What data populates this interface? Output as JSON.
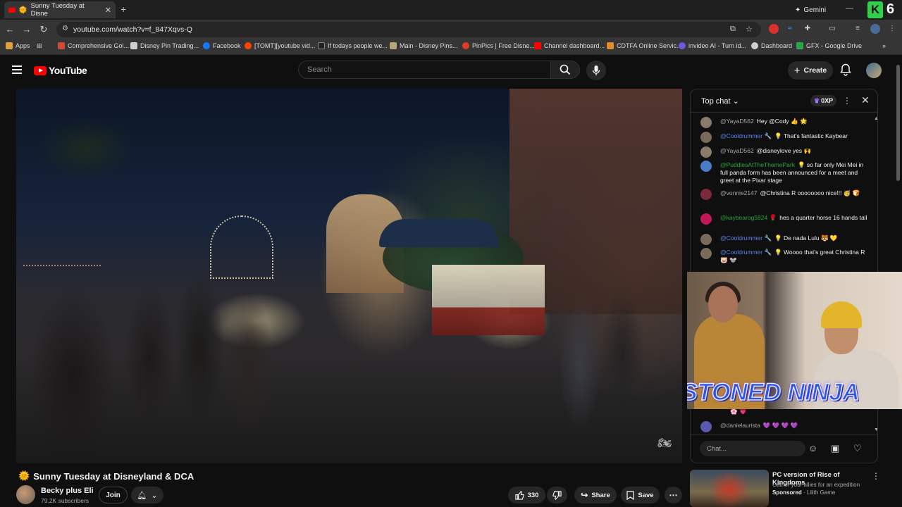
{
  "browser": {
    "tab_title": "Sunny Tuesday at Disne",
    "url": "youtube.com/watch?v=f_847Xqvs-Q",
    "gemini_label": "Gemini",
    "badge_count": "6",
    "bookmarks": [
      {
        "label": "Apps",
        "color": "#e0a040"
      },
      {
        "label": "Comprehensive Gol...",
        "color": "#d04a3a"
      },
      {
        "label": "Disney Pin Trading...",
        "color": "#cfcfcf"
      },
      {
        "label": "Facebook",
        "color": "#1877f2"
      },
      {
        "label": "[TOMT][youtube vid...",
        "color": "#ff4500"
      },
      {
        "label": "If todays people we...",
        "color": "#202020"
      },
      {
        "label": "Main - Disney Pins...",
        "color": "#b3a47a"
      },
      {
        "label": "PinPics | Free Disne...",
        "color": "#e03a2a"
      },
      {
        "label": "Channel dashboard...",
        "color": "#ff0000"
      },
      {
        "label": "CDTFA Online Servic...",
        "color": "#e08a2a"
      },
      {
        "label": "invideo AI - Turn id...",
        "color": "#6a5ae0"
      },
      {
        "label": "Dashboard",
        "color": "#cfcfcf"
      },
      {
        "label": "GFX - Google Drive",
        "color": "#2aa44a"
      }
    ]
  },
  "youtube": {
    "logo_text": "YouTube",
    "search_placeholder": "Search",
    "create_label": "Create"
  },
  "video": {
    "title": "Sunny Tuesday at Disneyland & DCA",
    "title_emoji": "🌞",
    "channel_name": "Becky plus Eli",
    "subscribers": "79.2K subscribers",
    "join_label": "Join",
    "like_count": "330",
    "share_label": "Share",
    "save_label": "Save"
  },
  "webcam": {
    "overlay_text": "STONED NINJA"
  },
  "chat": {
    "header": "Top chat",
    "xp": "0XP",
    "input_placeholder": "Chat...",
    "messages": [
      {
        "author": "@YayaD562",
        "role": "viewer",
        "text": "Hey @Cody 👍 🌟",
        "avatar": "#8a7a6a"
      },
      {
        "author": "@Cooldrummer 🔧",
        "role": "mod",
        "text": "💡 That's fantastic Kaybear",
        "avatar": "#7a6a5a"
      },
      {
        "author": "@YayaD562",
        "role": "viewer",
        "text": "@disneylove yes 🙌",
        "avatar": "#8a7a6a"
      },
      {
        "author": "@PuddlesAtTheThemePark",
        "role": "member",
        "text": "💡 so far only Mei Mei in full panda form has been announced for a meet and greet at the Pixar stage",
        "avatar": "#4a7ac8"
      },
      {
        "author": "@vonnie2147",
        "role": "viewer",
        "text": "@Christina R oooooooo nice!!! 🥳 🍞",
        "avatar": "#7a2a3a"
      },
      {
        "author": "@kaybearog5824 🌹",
        "role": "member",
        "text": "hes a quarter horse 16 hands tall",
        "avatar": "#c2185b"
      },
      {
        "author": "@Cooldrummer 🔧",
        "role": "mod",
        "text": "💡 De nada Lulu 🐯 💛",
        "avatar": "#7a6a5a"
      },
      {
        "author": "@Cooldrummer 🔧",
        "role": "mod",
        "text": "💡 Woooo that's great Christina R 🐷 🐭",
        "avatar": "#7a6a5a"
      },
      {
        "author": "@danielaurista",
        "role": "viewer",
        "text": "💜 💜 💜 💜",
        "avatar": "#5a5ab0"
      }
    ],
    "partial_message": "🌸 💗"
  },
  "ad": {
    "title": "PC version of Rise of Kingdoms",
    "subtitle": "Gather your allies for an expedition",
    "sponsored_label": "Sponsored",
    "advertiser": "Lilith Game"
  }
}
